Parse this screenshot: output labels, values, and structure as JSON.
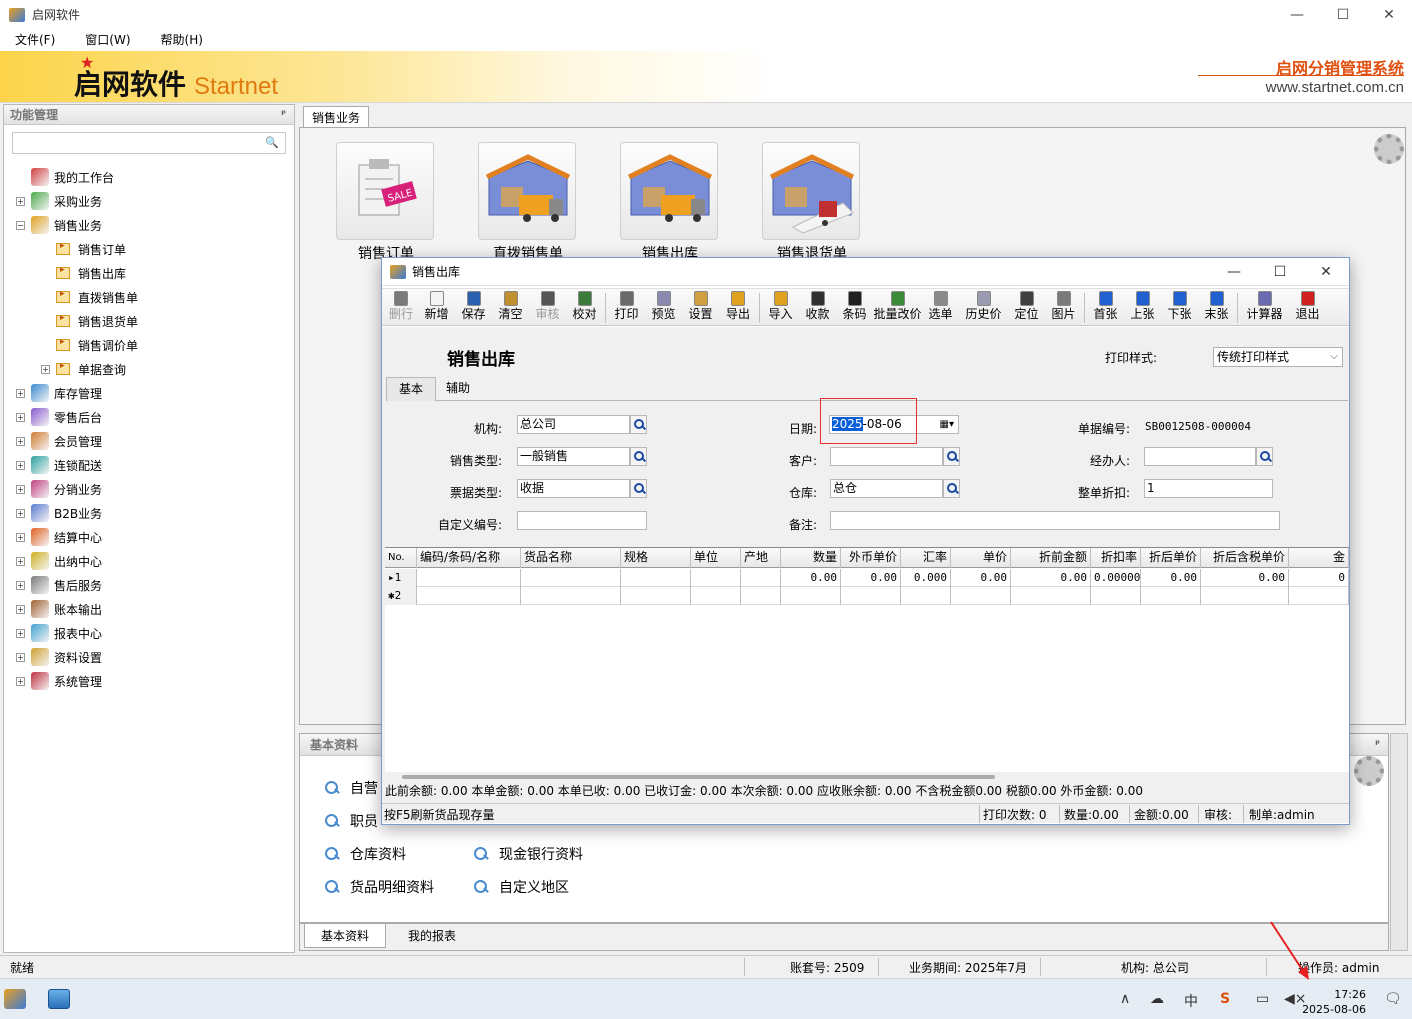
{
  "window": {
    "title": "启网软件"
  },
  "menu": [
    "文件(F)",
    "窗口(W)",
    "帮助(H)"
  ],
  "banner": {
    "brand": "启网软件",
    "brand_en": "Startnet",
    "system": "启网分销管理系统",
    "url": "www.startnet.com.cn"
  },
  "left_panel": {
    "title": "功能管理",
    "tree": [
      {
        "label": "我的工作台",
        "expandable": false
      },
      {
        "label": "采购业务",
        "expandable": true,
        "expanded": false
      },
      {
        "label": "销售业务",
        "expandable": true,
        "expanded": true,
        "children": [
          "销售订单",
          "销售出库",
          "直拨销售单",
          "销售退货单",
          "销售调价单",
          "单据查询"
        ]
      },
      {
        "label": "库存管理",
        "expandable": true
      },
      {
        "label": "零售后台",
        "expandable": true
      },
      {
        "label": "会员管理",
        "expandable": true
      },
      {
        "label": "连锁配送",
        "expandable": true
      },
      {
        "label": "分销业务",
        "expandable": true
      },
      {
        "label": "B2B业务",
        "expandable": true
      },
      {
        "label": "结算中心",
        "expandable": true
      },
      {
        "label": "出纳中心",
        "expandable": true
      },
      {
        "label": "售后服务",
        "expandable": true
      },
      {
        "label": "账本输出",
        "expandable": true
      },
      {
        "label": "报表中心",
        "expandable": true
      },
      {
        "label": "资料设置",
        "expandable": true
      },
      {
        "label": "系统管理",
        "expandable": true
      }
    ]
  },
  "main": {
    "tab": "销售业务",
    "modules": [
      "销售订单",
      "直拨销售单",
      "销售出库",
      "销售退货单"
    ],
    "basic_title": "基本资料",
    "basic_links": [
      "自营",
      "职员",
      "仓库资料",
      "现金银行资料",
      "货品明细资料",
      "自定义地区"
    ],
    "bottom_tabs": [
      "基本资料",
      "我的报表"
    ]
  },
  "dialog": {
    "title": "销售出库",
    "toolbar": [
      {
        "label": "删行",
        "disabled": true,
        "color": "#7a7a7a"
      },
      {
        "label": "新增",
        "color": "#f4f4f4"
      },
      {
        "label": "保存",
        "color": "#2b5fb0"
      },
      {
        "label": "清空",
        "color": "#c09030"
      },
      {
        "label": "审核",
        "disabled": true,
        "color": "#555555"
      },
      {
        "label": "校对",
        "color": "#3a7a3a"
      },
      {
        "label": "打印",
        "color": "#6a6a6a"
      },
      {
        "label": "预览",
        "color": "#8a8ab0"
      },
      {
        "label": "设置",
        "color": "#d0a040"
      },
      {
        "label": "导出",
        "color": "#e0a020"
      },
      {
        "label": "导入",
        "color": "#e0a020"
      },
      {
        "label": "收款",
        "color": "#303030"
      },
      {
        "label": "条码",
        "color": "#202020"
      },
      {
        "label": "批量改价",
        "color": "#3a8a3a"
      },
      {
        "label": "选单",
        "color": "#8a8a8a"
      },
      {
        "label": "历史价",
        "color": "#9a9ab0"
      },
      {
        "label": "定位",
        "color": "#404040"
      },
      {
        "label": "图片",
        "color": "#7a7a7a"
      },
      {
        "label": "首张",
        "color": "#2060d0"
      },
      {
        "label": "上张",
        "color": "#2060d0"
      },
      {
        "label": "下张",
        "color": "#2060d0"
      },
      {
        "label": "末张",
        "color": "#2060d0"
      },
      {
        "label": "计算器",
        "color": "#6a6ab0"
      },
      {
        "label": "退出",
        "color": "#d02020"
      }
    ],
    "form_title": "销售出库",
    "print_style_label": "打印样式:",
    "print_style_value": "传统打印样式",
    "tabs": [
      "基本",
      "辅助"
    ],
    "fields": {
      "org_label": "机构:",
      "org_value": "总公司",
      "date_label": "日期:",
      "date_year": "2025",
      "date_rest": "-08-06",
      "doc_no_label": "单据编号:",
      "doc_no_value": "SB0012508-000004",
      "sale_type_label": "销售类型:",
      "sale_type_value": "一般销售",
      "customer_label": "客户:",
      "customer_value": "",
      "handler_label": "经办人:",
      "handler_value": "",
      "ticket_type_label": "票据类型:",
      "ticket_type_value": "收据",
      "warehouse_label": "仓库:",
      "warehouse_value": "总仓",
      "discount_label": "整单折扣:",
      "discount_value": "1",
      "custom_no_label": "自定义编号:",
      "custom_no_value": "",
      "remark_label": "备注:",
      "remark_value": ""
    },
    "grid": {
      "columns": [
        "No.",
        "编码/条码/名称",
        "货品名称",
        "规格",
        "单位",
        "产地",
        "数量",
        "外币单价",
        "汇率",
        "单价",
        "折前金额",
        "折扣率",
        "折后单价",
        "折后含税单价",
        "金"
      ],
      "rows": [
        {
          "no": "▸1",
          "cells": [
            "",
            "",
            "",
            "",
            "",
            "0.00",
            "0.00",
            "0.000",
            "0.00",
            "0.00",
            "0.00000",
            "0.00",
            "0.00",
            "0"
          ]
        },
        {
          "no": "✱2",
          "cells": [
            "",
            "",
            "",
            "",
            "",
            "",
            "",
            "",
            "",
            "",
            "",
            "",
            "",
            ""
          ]
        }
      ]
    },
    "summary": "此前余额: 0.00 本单金额: 0.00 本单已收: 0.00 已收订金: 0.00 本次余额: 0.00 应收账余额: 0.00 不含税金额0.00 税额0.00 外币金额: 0.00",
    "status": {
      "hint": "按F5刷新货品现存量",
      "print_count": "打印次数: 0",
      "qty": "数量:0.00",
      "amount": "金额:0.00",
      "audit": "审核:",
      "maker": "制单:admin"
    }
  },
  "statusbar": {
    "ready": "就绪",
    "account": "账套号: 2509",
    "period": "业务期间: 2025年7月",
    "org": "机构: 总公司",
    "operator": "操作员: admin"
  },
  "taskbar": {
    "time": "17:26",
    "date": "2025-08-06",
    "ime": "中"
  }
}
